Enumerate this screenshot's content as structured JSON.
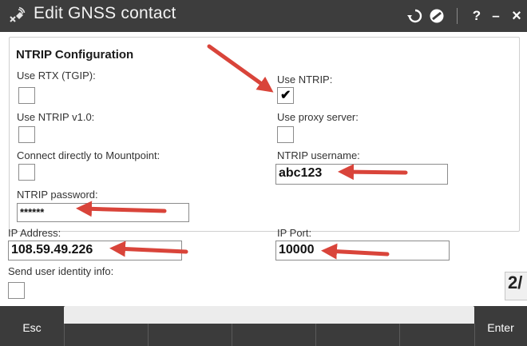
{
  "window": {
    "title": "Edit GNSS contact",
    "icons": [
      "gnss-contact-icon",
      "back-icon",
      "no-entry-icon",
      "help-icon",
      "minimize-icon",
      "close-icon"
    ],
    "help_label": "?",
    "minimize_label": "–",
    "close_label": "×"
  },
  "section": {
    "title": "NTRIP Configuration"
  },
  "fields": {
    "use_rtx": {
      "label": "Use RTX (TGIP):",
      "checked": false
    },
    "use_ntrip": {
      "label": "Use NTRIP:",
      "checked": true,
      "checkmark": "✔"
    },
    "use_ntrip_v1": {
      "label": "Use NTRIP v1.0:",
      "checked": false
    },
    "use_proxy": {
      "label": "Use proxy server:",
      "checked": false
    },
    "connect_mountpoint": {
      "label": "Connect directly to Mountpoint:",
      "checked": false
    },
    "ntrip_username": {
      "label": "NTRIP username:",
      "value": "abc123"
    },
    "ntrip_password": {
      "label": "NTRIP password:",
      "value": "******"
    },
    "ip_address": {
      "label": "IP Address:",
      "value": "108.59.49.226"
    },
    "ip_port": {
      "label": "IP Port:",
      "value": "10000"
    },
    "send_identity": {
      "label": "Send user identity info:",
      "checked": false
    }
  },
  "page_indicator": "2/",
  "bottom_bar": {
    "esc_label": "Esc",
    "enter_label": "Enter"
  },
  "colors": {
    "titlebar": "#3d3d3d",
    "bottombar": "#3b3b3b",
    "annotation_arrow": "#d9443a"
  }
}
